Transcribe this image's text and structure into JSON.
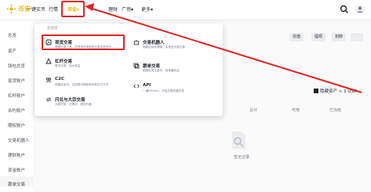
{
  "brand": {
    "name": "币安",
    "color": "#f0b90b"
  },
  "nav": {
    "buy_crypto": "一键买币",
    "markets": "行情",
    "assets": "资金",
    "finance": "理财",
    "square": "广场",
    "more": "更多"
  },
  "sidebar": {
    "items": [
      {
        "label": "总览"
      },
      {
        "label": "资产"
      },
      {
        "label": "钱包总览"
      },
      {
        "label": "现货账户"
      },
      {
        "label": "杠杆账户"
      },
      {
        "label": "合约账户"
      },
      {
        "label": "期权账户"
      },
      {
        "label": "交易机器人"
      },
      {
        "label": "理财账户"
      },
      {
        "label": "资金账户"
      },
      {
        "label": "跟单交易"
      }
    ]
  },
  "actions": {
    "deposit": "充值",
    "withdraw": "提现",
    "transfer": "划转"
  },
  "hide_assets": {
    "label": "隐藏资产 < 1 USD"
  },
  "columns": {
    "col1": "总计",
    "col2": "可用",
    "col3": "已冻结"
  },
  "empty": {
    "text": "暂无记录"
  },
  "dropdown": {
    "header": "基础版",
    "items": [
      {
        "title": "现货交易",
        "desc": "便捷交易工具，在现货市场轻松交易加密货币"
      },
      {
        "title": "杠杆交易",
        "desc": "借币交易，放大收益"
      },
      {
        "title": "C2C",
        "desc": "快捷买卖币，支持银行转账和多种支付方式"
      },
      {
        "title": "闪兑与大宗交易",
        "desc": "大额交易，无滑点，更优价格"
      },
      {
        "title": "交易机器人",
        "desc": "借助自动化策略，实现全天候交易"
      },
      {
        "title": "跟单交易",
        "desc": "跟随优秀交易员，轻松赚收益"
      },
      {
        "title": "API",
        "desc": "一键API Key，开启无限机器交易"
      }
    ]
  },
  "colors": {
    "highlight": "#e02424",
    "accent": "#f0b90b"
  }
}
